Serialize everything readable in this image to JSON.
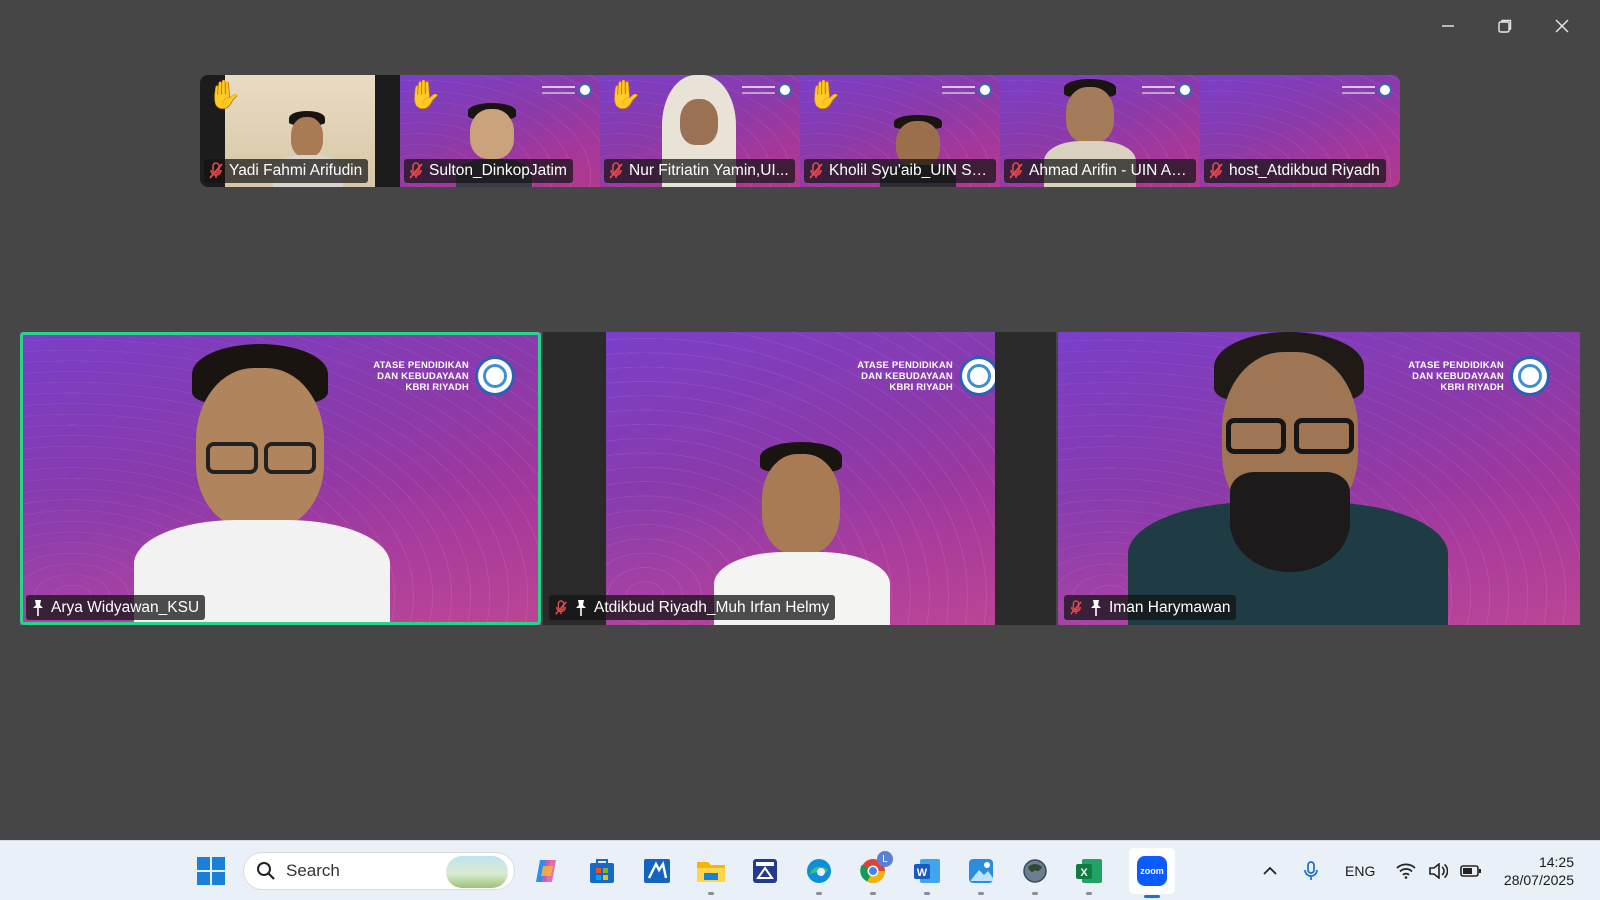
{
  "gallery": [
    {
      "name": "Yadi Fahmi Arifudin",
      "hand_raised": true,
      "muted": true
    },
    {
      "name": "Sulton_DinkopJatim",
      "hand_raised": true,
      "muted": true
    },
    {
      "name": "Nur Fitriatin Yamin,UI...",
      "hand_raised": true,
      "muted": true
    },
    {
      "name": "Kholil Syu'aib_UIN SUT...",
      "hand_raised": true,
      "muted": true
    },
    {
      "name": "Ahmad Arifin - UIN An...",
      "hand_raised": false,
      "muted": true
    },
    {
      "name": "host_Atdikbud Riyadh",
      "hand_raised": false,
      "muted": true
    }
  ],
  "main": [
    {
      "name": "Arya Widyawan_KSU",
      "active_speaker": true,
      "muted": false
    },
    {
      "name": "Atdikbud Riyadh_Muh Irfan Helmy",
      "active_speaker": false,
      "muted": true
    },
    {
      "name": "Iman Harymawan",
      "active_speaker": false,
      "muted": true
    }
  ],
  "background_logo": {
    "line1": "ATASE PENDIDIKAN",
    "line2": "DAN KEBUDAYAAN",
    "line3": "KBRI RIYADH"
  },
  "taskbar": {
    "search_label": "Search",
    "chrome_badge": "L",
    "zoom_label": "zoom",
    "language": "ENG",
    "time": "14:25",
    "date": "28/07/2025"
  },
  "colors": {
    "window_bg": "#464646",
    "active_speaker_border": "#2bd48a",
    "taskbar_bg": "#eaf0f8",
    "raise_hand": "#f7c531",
    "mute_red": "#e5484d"
  }
}
